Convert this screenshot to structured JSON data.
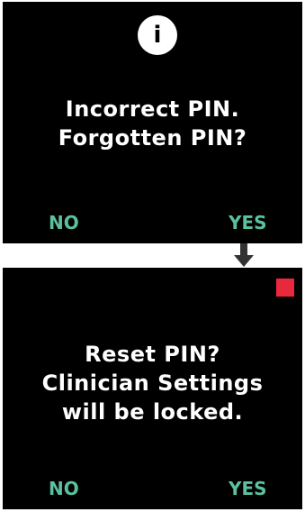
{
  "screens": [
    {
      "icon": "info-icon",
      "icon_glyph": "i",
      "message_lines": [
        "Incorrect PIN.",
        "Forgotten PIN?"
      ],
      "no_label": "NO",
      "yes_label": "YES"
    },
    {
      "indicator": "alert-square-icon",
      "message_lines": [
        "Reset PIN?",
        "Clinician Settings",
        "will be locked."
      ],
      "no_label": "NO",
      "yes_label": "YES"
    }
  ],
  "flow": {
    "arrow_icon": "down-arrow-icon"
  },
  "colors": {
    "screen_background": "#000000",
    "message_text": "#ffffff",
    "soft_key": "#5bc0a0",
    "alert": "#e8283c",
    "arrow": "#333333"
  }
}
